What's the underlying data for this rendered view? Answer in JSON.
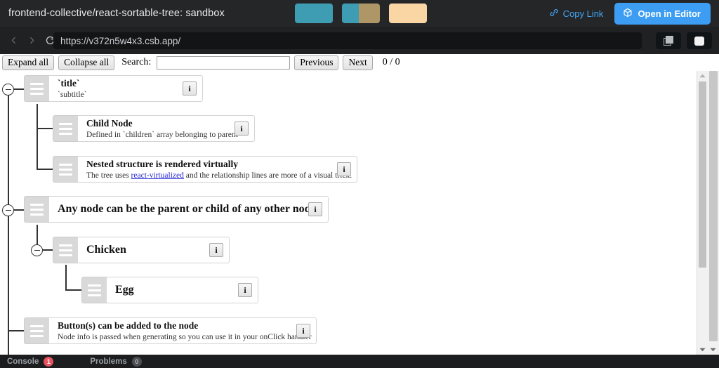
{
  "topbar": {
    "title": "frontend-collective/react-sortable-tree: sandbox",
    "swatches": [
      {
        "name": "swatch-teal",
        "colors": [
          "#3e9cb3"
        ]
      },
      {
        "name": "swatch-teal-tan",
        "colors": [
          "#3e9cb3",
          "#ae9667"
        ]
      },
      {
        "name": "swatch-peach",
        "colors": [
          "#fad6a5"
        ]
      }
    ],
    "copy_link_label": "Copy Link",
    "open_editor_label": "Open in Editor",
    "accent_blue": "#3d9df2",
    "link_blue": "#45a7f5",
    "bg": "#242628"
  },
  "urlbar": {
    "back_icon": "chevron-left-icon",
    "forward_icon": "chevron-right-icon",
    "reload_icon": "reload-icon",
    "url": "https://v372n5w4x3.csb.app/",
    "placeholder": "Enter URL",
    "split_view_icon": "split-view-icon",
    "preview_icon": "preview-window-icon"
  },
  "toolbar": {
    "expand_all": "Expand all",
    "collapse_all": "Collapse all",
    "search_label": "Search:",
    "search_value": "",
    "search_placeholder": "",
    "previous": "Previous",
    "next": "Next",
    "match_count": "0 / 0"
  },
  "tree": {
    "nodes": [
      {
        "id": "n1",
        "title": "`title`",
        "subtitle": "`subtitle`",
        "info_label": "i",
        "depth": 0,
        "collapsible": true
      },
      {
        "id": "n2",
        "title": "Child Node",
        "subtitle": "Defined in `children` array belonging to parent",
        "info_label": "i",
        "depth": 1,
        "collapsible": false
      },
      {
        "id": "n3",
        "title": "Nested structure is rendered virtually",
        "subtitle_pre": "The tree uses ",
        "subtitle_link": "react-virtualized",
        "subtitle_post": " and the relationship lines are more of a visual trick.",
        "info_label": "i",
        "depth": 1,
        "collapsible": false
      },
      {
        "id": "n4",
        "title": "Any node can be the parent or child of any other node",
        "subtitle": "",
        "info_label": "i",
        "depth": 0,
        "collapsible": true
      },
      {
        "id": "n5",
        "title": "Chicken",
        "subtitle": "",
        "info_label": "i",
        "depth": 1,
        "collapsible": true
      },
      {
        "id": "n6",
        "title": "Egg",
        "subtitle": "",
        "info_label": "i",
        "depth": 2,
        "collapsible": false
      },
      {
        "id": "n7",
        "title": "Button(s) can be added to the node",
        "subtitle": "Node info is passed when generating so you can use it in your onClick handler",
        "info_label": "i",
        "depth": 0,
        "collapsible": false
      }
    ],
    "handle_icon": "drag-handle-icon",
    "collapse_icon": "minus-circle-icon"
  },
  "scrollbar": {
    "up_icon": "scroll-up-arrow-icon",
    "down_icon": "scroll-down-arrow-icon"
  },
  "bottombar": {
    "console_label": "Console",
    "console_count": "1",
    "problems_label": "Problems",
    "problems_count": "0",
    "console_badge_color": "#e8525f",
    "problems_badge_color": "#4a4e52"
  }
}
